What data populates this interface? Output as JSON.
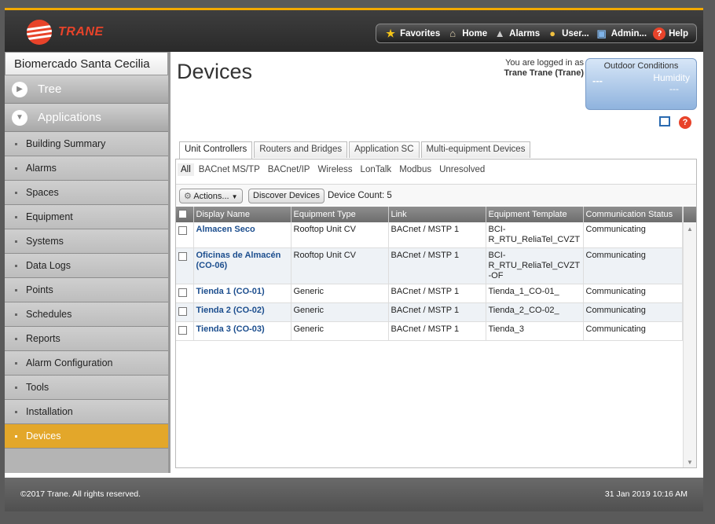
{
  "brand": {
    "logo_text": "TRANE"
  },
  "topnav": [
    {
      "label": "Favorites",
      "icon": "star-icon"
    },
    {
      "label": "Home",
      "icon": "home-icon"
    },
    {
      "label": "Alarms",
      "icon": "bell-icon"
    },
    {
      "label": "User...",
      "icon": "user-icon"
    },
    {
      "label": "Admin...",
      "icon": "monitor-icon"
    },
    {
      "label": "Help",
      "icon": "help-icon"
    }
  ],
  "sidebar": {
    "site_name": "Biomercado Santa Cecilia",
    "tree_label": "Tree",
    "applications_label": "Applications",
    "items": [
      "Building Summary",
      "Alarms",
      "Spaces",
      "Equipment",
      "Systems",
      "Data Logs",
      "Points",
      "Schedules",
      "Reports",
      "Alarm Configuration",
      "Tools",
      "Installation",
      "Devices"
    ],
    "active": "Devices"
  },
  "page": {
    "title": "Devices",
    "logged_in_text": "You are logged in as",
    "logged_in_user": "Trane Trane (Trane)"
  },
  "outdoor": {
    "title": "Outdoor Conditions",
    "temp": "---",
    "humidity_label": "Humidity",
    "humidity": "---"
  },
  "tabs": [
    "Unit Controllers",
    "Routers and Bridges",
    "Application SC",
    "Multi-equipment Devices"
  ],
  "subtabs": [
    "All",
    "BACnet MS/TP",
    "BACnet/IP",
    "Wireless",
    "LonTalk",
    "Modbus",
    "Unresolved"
  ],
  "toolbar": {
    "actions_label": "Actions...",
    "discover_label": "Discover Devices",
    "count_text": "Device Count: 5"
  },
  "table": {
    "columns": [
      "Display Name",
      "Equipment Type",
      "Link",
      "Equipment Template",
      "Communication Status"
    ],
    "rows": [
      [
        "Almacen Seco",
        "Rooftop Unit CV",
        "BACnet / MSTP 1",
        "BCI-R_RTU_ReliaTel_CVZT",
        "Communicating"
      ],
      [
        "Oficinas de Almacén (CO-06)",
        "Rooftop Unit CV",
        "BACnet / MSTP 1",
        "BCI-R_RTU_ReliaTel_CVZT-OF",
        "Communicating"
      ],
      [
        "Tienda 1 (CO-01)",
        "Generic",
        "BACnet / MSTP 1",
        "Tienda_1_CO-01_",
        "Communicating"
      ],
      [
        "Tienda 2 (CO-02)",
        "Generic",
        "BACnet / MSTP 1",
        "Tienda_2_CO-02_",
        "Communicating"
      ],
      [
        "Tienda 3 (CO-03)",
        "Generic",
        "BACnet / MSTP 1",
        "Tienda_3",
        "Communicating"
      ]
    ]
  },
  "footer": {
    "copyright": "©2017 Trane. All rights reserved.",
    "datetime": "31 Jan 2019 10:16 AM"
  },
  "colors": {
    "accent": "#e3a72a",
    "brand": "#e8432a",
    "link": "#1c4e8e"
  }
}
